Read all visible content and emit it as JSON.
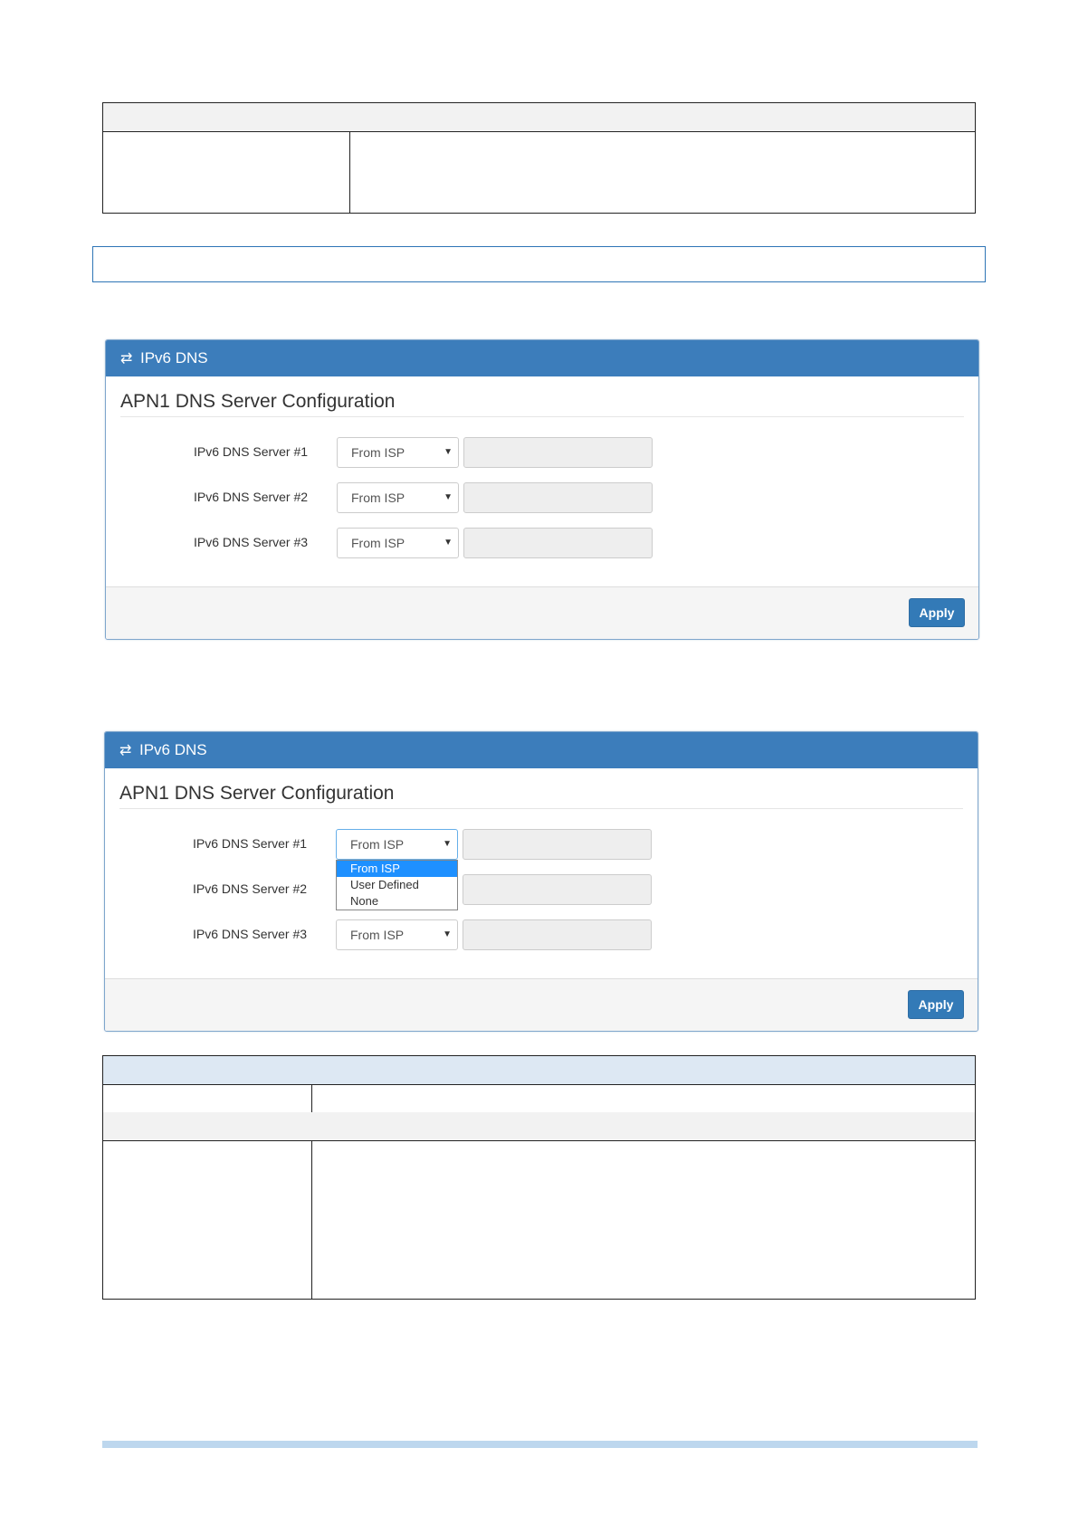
{
  "panels": [
    {
      "header": "IPv6 DNS",
      "title": "APN1 DNS Server Configuration",
      "rows": [
        {
          "label": "IPv6 DNS Server #1",
          "select": "From ISP"
        },
        {
          "label": "IPv6 DNS Server #2",
          "select": "From ISP"
        },
        {
          "label": "IPv6 DNS Server #3",
          "select": "From ISP"
        }
      ],
      "apply": "Apply"
    },
    {
      "header": "IPv6 DNS",
      "title": "APN1 DNS Server Configuration",
      "rows": [
        {
          "label": "IPv6 DNS Server #1",
          "select": "From ISP"
        },
        {
          "label": "IPv6 DNS Server #2",
          "select": "From ISP"
        },
        {
          "label": "IPv6 DNS Server #3",
          "select": "From ISP"
        }
      ],
      "apply": "Apply",
      "dropdown_options": [
        "From ISP",
        "User Defined",
        "None"
      ]
    }
  ],
  "icons": {
    "header": "exchange-arrows-icon",
    "select": "caret-down-icon"
  }
}
